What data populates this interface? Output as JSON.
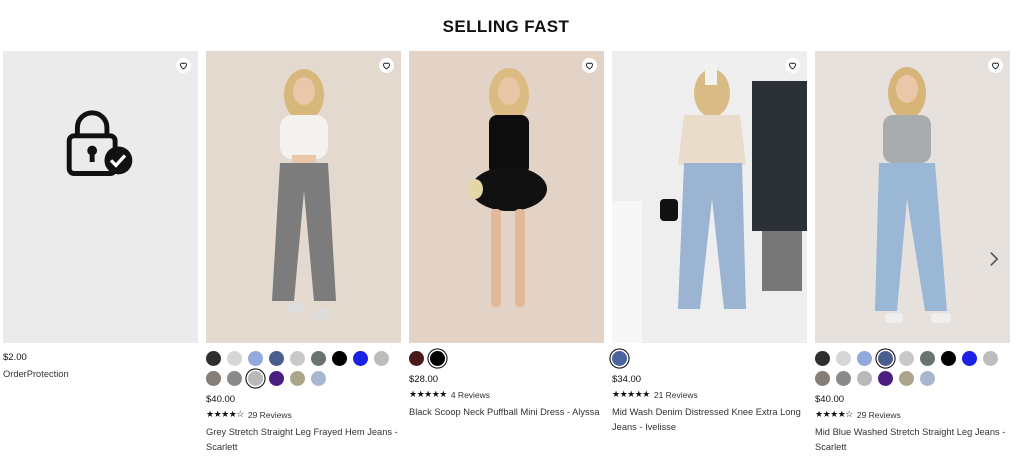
{
  "section": {
    "title": "SELLING FAST"
  },
  "order_protection": {
    "price": "$2.00",
    "name": "OrderProtection"
  },
  "products": [
    {
      "price": "$40.00",
      "stars": "★★★★☆",
      "reviews": "29 Reviews",
      "name": "Grey Stretch Straight Leg Frayed Hem Jeans - Scarlett",
      "swatches": [
        "#2e2e2e",
        "#d6d6d6",
        "#93a8dc",
        "#4b5f8f",
        "#c9c9c9",
        "#6a7372",
        "#000000",
        "#1b22e6",
        "#bdbdbd",
        "#857d77",
        "#8a8a8a",
        "#b9b9b9",
        "#4b1e82",
        "#ada58b",
        "#a7b7cf"
      ],
      "selected": 11,
      "bg": "#e4d9cf"
    },
    {
      "price": "$28.00",
      "stars": "★★★★★",
      "reviews": "4 Reviews",
      "name": "Black Scoop Neck Puffball Mini Dress - Alyssa",
      "swatches": [
        "#4a1a1a",
        "#000000"
      ],
      "selected": 1,
      "bg": "#e2d3c6"
    },
    {
      "price": "$34.00",
      "stars": "★★★★★",
      "reviews": "21 Reviews",
      "name": "Mid Wash Denim Distressed Knee Extra Long Jeans - Ivelisse",
      "swatches": [
        "#4b64a0"
      ],
      "selected": 0,
      "bg": "#eeeeee"
    },
    {
      "price": "$40.00",
      "stars": "★★★★☆",
      "reviews": "29 Reviews",
      "name": "Mid Blue Washed Stretch Straight Leg Jeans - Scarlett",
      "swatches": [
        "#2e2e2e",
        "#d6d6d6",
        "#93a8dc",
        "#4b5f8f",
        "#c9c9c9",
        "#6a7372",
        "#000000",
        "#1b22e6",
        "#bdbdbd",
        "#857d77",
        "#8a8a8a",
        "#b9b9b9",
        "#4b1e82",
        "#ada58b",
        "#a7b7cf"
      ],
      "selected": 3,
      "bg": "#e6e1dd"
    }
  ],
  "icons": {
    "wishlist": "heart-icon",
    "next": "chevron-right-icon",
    "lock": "padlock-check-icon"
  }
}
